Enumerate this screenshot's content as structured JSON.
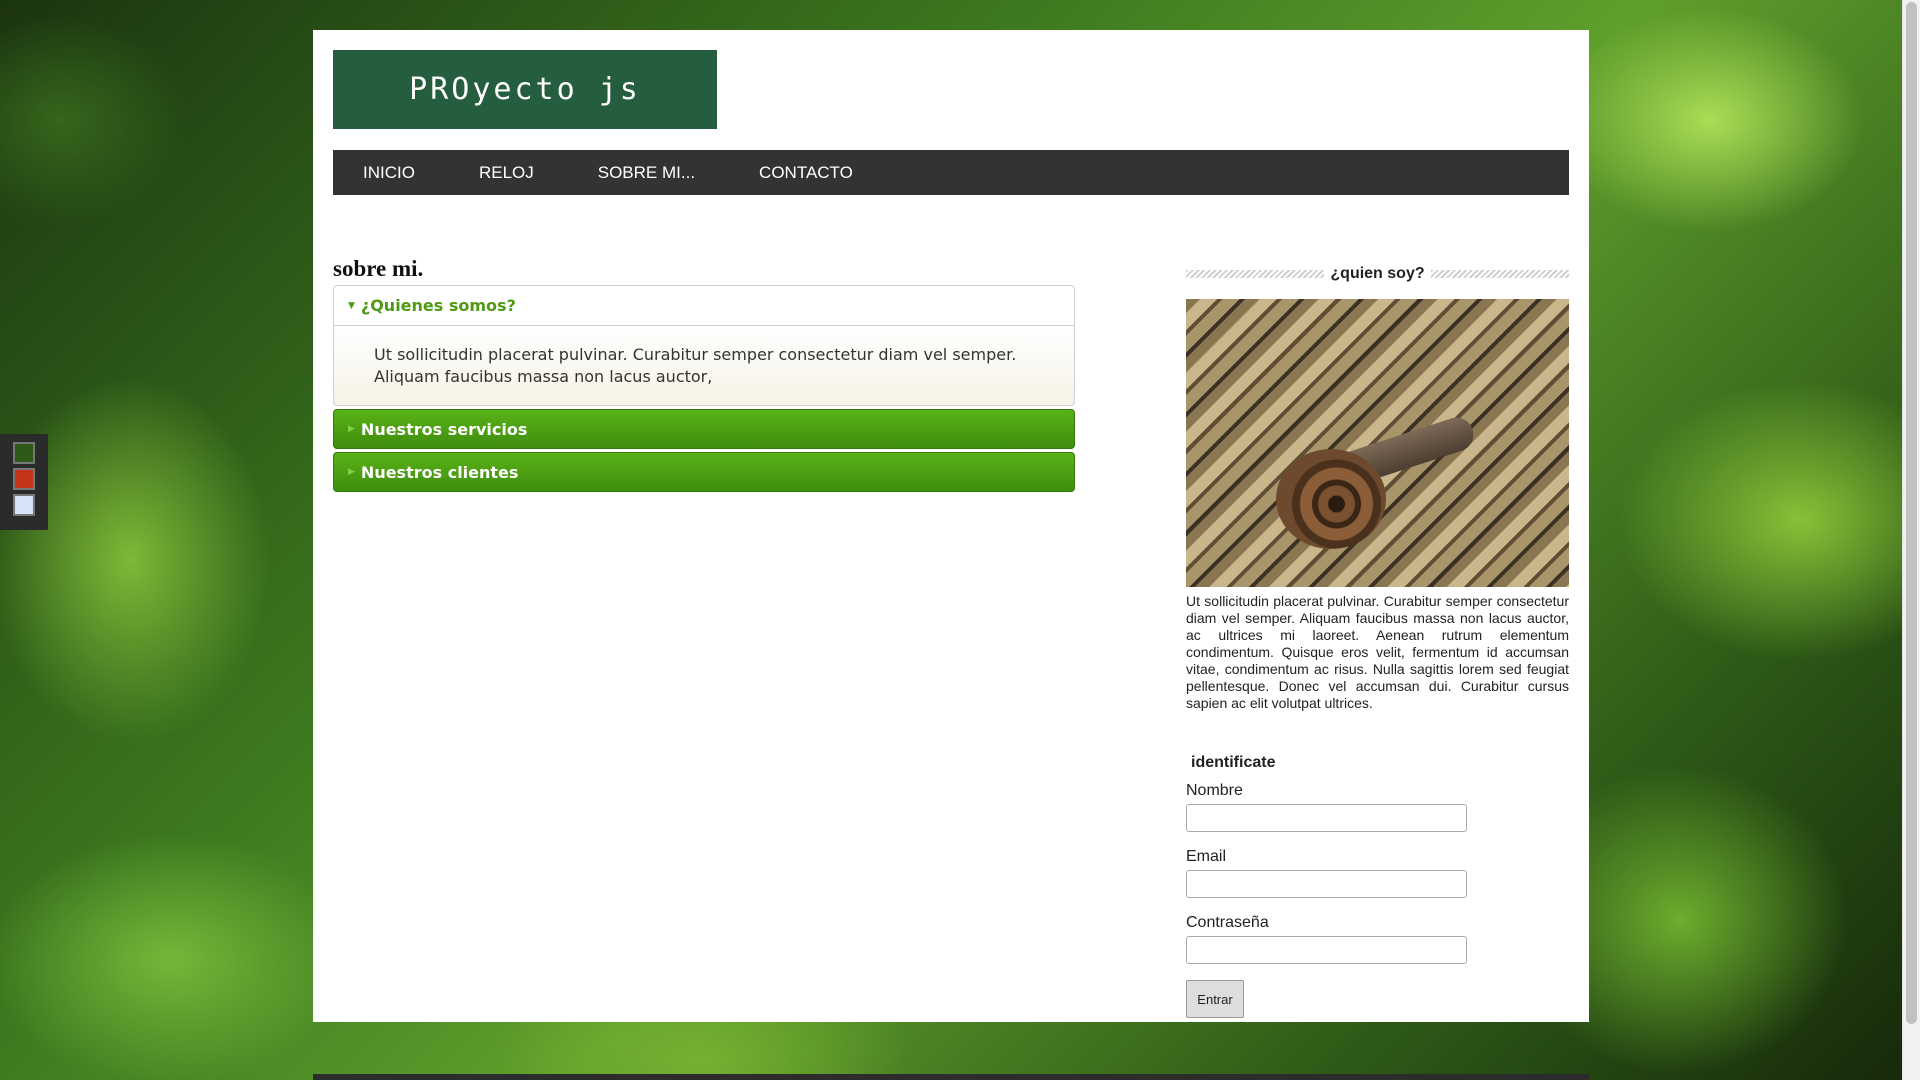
{
  "header": {
    "logo_text": "PROyecto js"
  },
  "nav": {
    "items": [
      "INICIO",
      "RELOJ",
      "SOBRE MI...",
      "CONTACTO"
    ]
  },
  "main": {
    "title": "sobre mi.",
    "accordion": [
      {
        "label": "¿Quienes somos?",
        "expanded": true,
        "content": "Ut sollicitudin placerat pulvinar. Curabitur semper consectetur diam vel semper. Aliquam faucibus massa non lacus auctor,"
      },
      {
        "label": "Nuestros servicios",
        "expanded": false
      },
      {
        "label": "Nuestros clientes",
        "expanded": false
      }
    ]
  },
  "sidebar": {
    "title": "¿quien soy?",
    "about_text": "Ut sollicitudin placerat pulvinar. Curabitur semper consectetur diam vel semper. Aliquam faucibus massa non lacus auctor, ac ultrices mi laoreet. Aenean rutrum elementum condimentum. Quisque eros velit, fermentum id accumsan vitae, condimentum ac risus. Nulla sagittis lorem sed feugiat pellentesque. Donec vel accumsan dui. Curabitur cursus sapien ac elit volutpat ultrices.",
    "login": {
      "legend": "identificate",
      "name_label": "Nombre",
      "email_label": "Email",
      "password_label": "Contraseña",
      "submit_label": "Entrar"
    }
  },
  "theme_switcher": {
    "colors": [
      "#2e5a17",
      "#c43418",
      "#d6e2f5"
    ]
  }
}
